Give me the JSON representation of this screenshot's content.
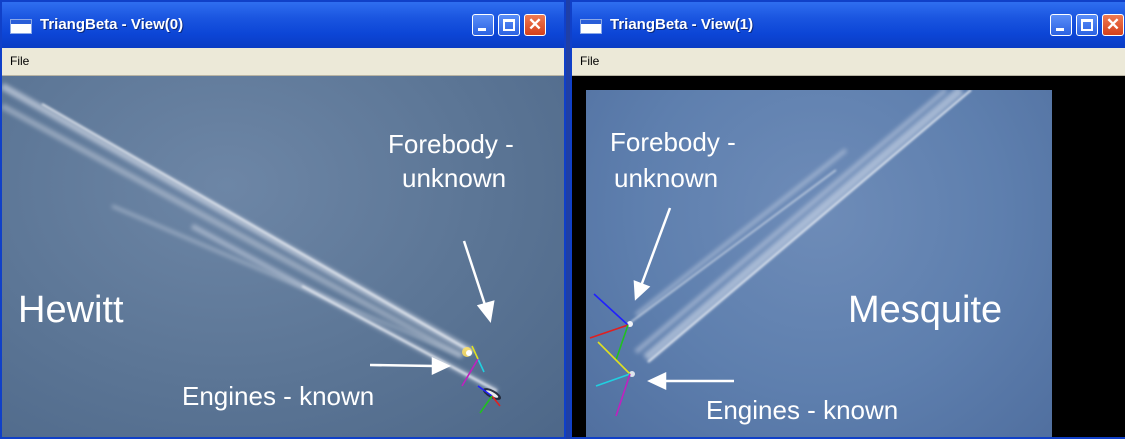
{
  "windows": [
    {
      "title": "TriangBeta - View(0)",
      "menu": [
        "File"
      ],
      "image": {
        "location_label": "Hewitt",
        "forebody_label": [
          "Forebody -",
          "unknown"
        ],
        "engines_label": "Engines - known"
      }
    },
    {
      "title": "TriangBeta - View(1)",
      "menu": [
        "File"
      ],
      "image": {
        "location_label": "Mesquite",
        "forebody_label": [
          "Forebody -",
          "unknown"
        ],
        "engines_label": "Engines - known"
      }
    }
  ],
  "colors": {
    "titlebar": "#0c45d6",
    "window_border": "#1040c8",
    "sky_view0": "#5b7595",
    "sky_view1": "#5e7fae",
    "annotation_text": "#ffffff",
    "axis_blue": "#2020ff",
    "axis_red": "#e02020",
    "axis_green": "#20c020",
    "axis_yellow": "#e0e020",
    "axis_cyan": "#20d0e0",
    "axis_magenta": "#c020c0"
  },
  "icons": [
    "app-window-icon",
    "minimize-icon",
    "maximize-icon",
    "close-icon"
  ]
}
